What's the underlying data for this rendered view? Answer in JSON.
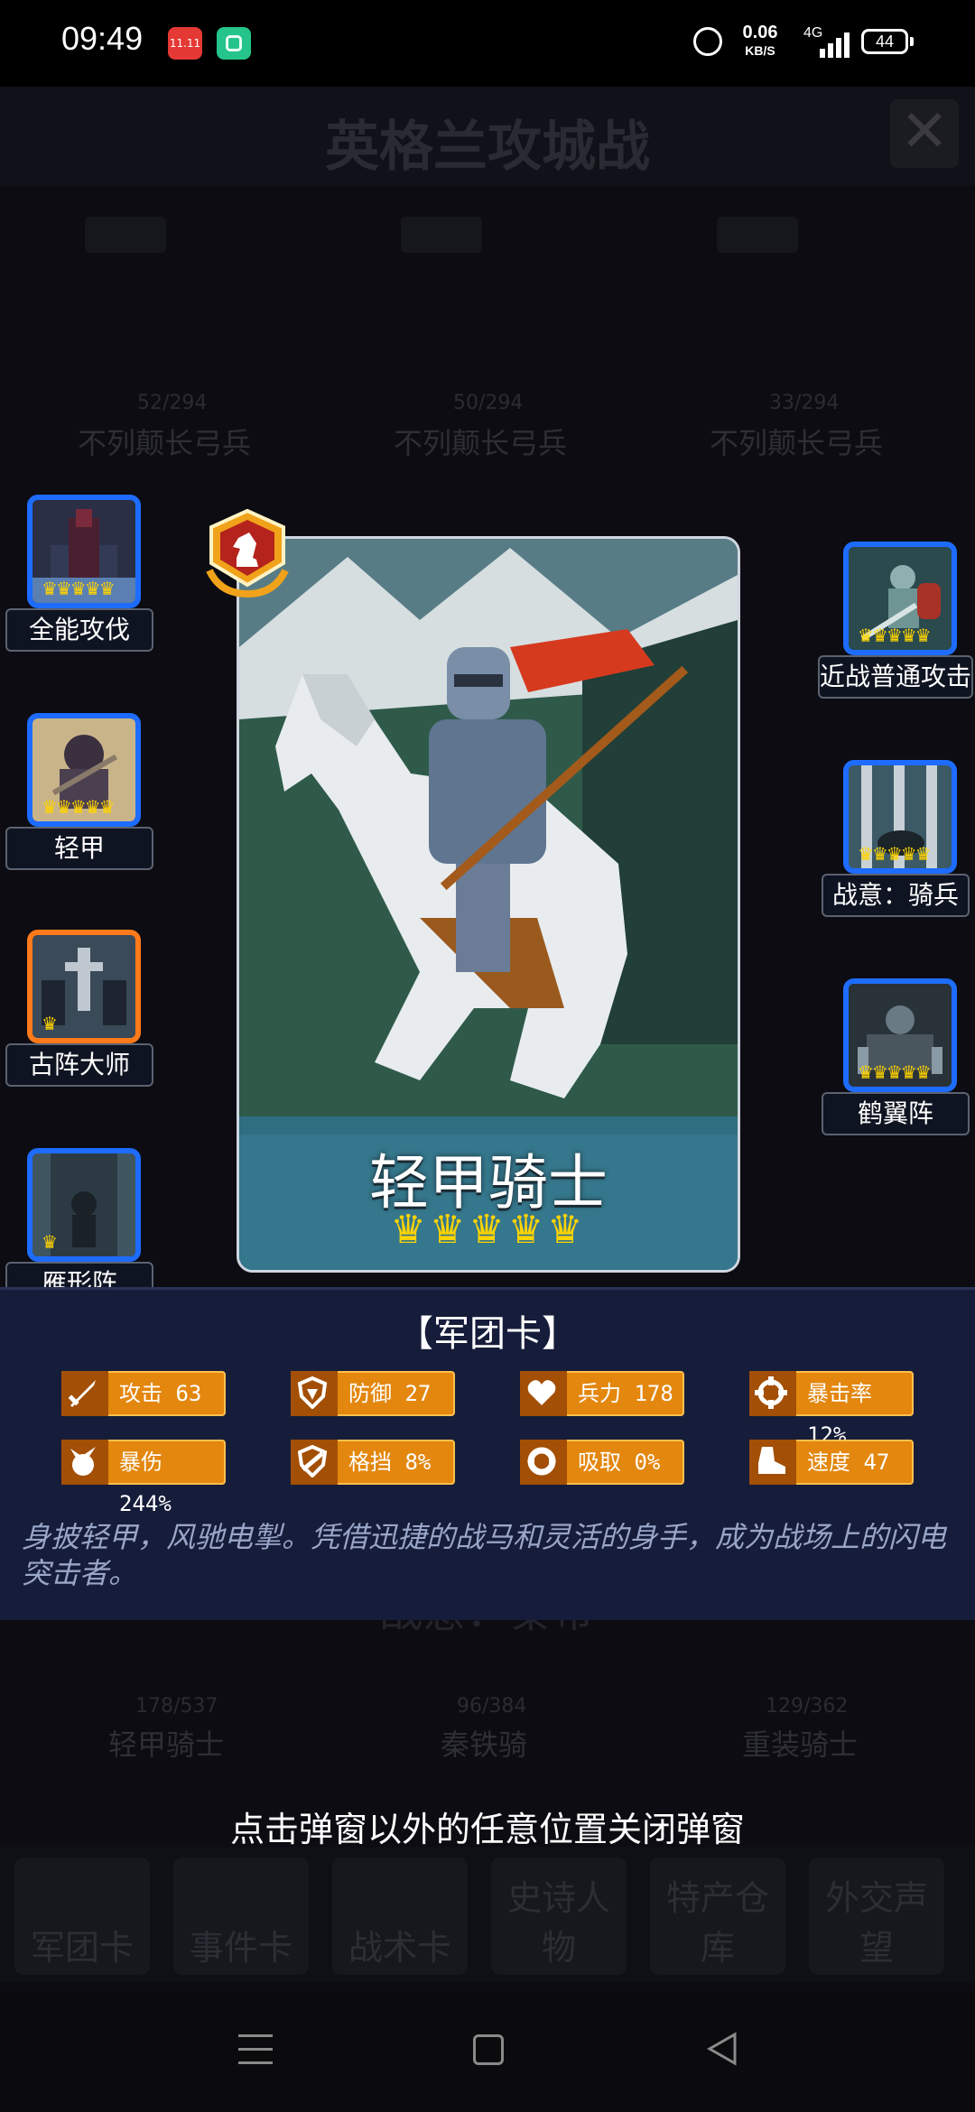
{
  "status_bar": {
    "time": "09:49",
    "app_badge": "11.11",
    "net_speed_value": "0.06",
    "net_speed_unit": "KB/S",
    "network": "4G",
    "battery": "44"
  },
  "background": {
    "title": "英格兰攻城战",
    "close_icon": "close-icon",
    "top_units": [
      {
        "stat": "52/294",
        "name": "不列颠长弓兵"
      },
      {
        "stat": "50/294",
        "name": "不列颠长弓兵"
      },
      {
        "stat": "33/294",
        "name": "不列颠长弓兵"
      }
    ],
    "center_text": "战意：秦帝",
    "bottom_units": [
      {
        "stat": "178/537",
        "name": "轻甲骑士"
      },
      {
        "stat": "96/384",
        "name": "秦铁骑"
      },
      {
        "stat": "129/362",
        "name": "重装骑士"
      }
    ],
    "hint": "点击弹窗以外的任意位置关闭弹窗",
    "nav": [
      "军团卡",
      "事件卡",
      "战术卡",
      "史诗人物",
      "特产仓库",
      "外交声望"
    ]
  },
  "skills_left": [
    {
      "label": "全能攻伐",
      "icon": "castle-icon",
      "crowns": "♛♛♛♛♛"
    },
    {
      "label": "轻甲",
      "icon": "hooded-warrior-icon",
      "crowns": "♛♛♛♛♛"
    },
    {
      "label": "古阵大师",
      "icon": "ancient-formation-icon",
      "crowns": "♛"
    },
    {
      "label": "雁形阵",
      "icon": "knight-formation-icon",
      "crowns": "♛"
    }
  ],
  "skills_right": [
    {
      "label": "近战普通攻击",
      "icon": "sword-knight-icon",
      "crowns": "♛♛♛♛♛"
    },
    {
      "label": "战意：骑兵",
      "icon": "cavalry-spirit-icon",
      "crowns": "♛♛♛♛♛"
    },
    {
      "label": "鹤翼阵",
      "icon": "crane-wing-formation-icon",
      "crowns": "♛♛♛♛♛"
    }
  ],
  "card": {
    "name": "轻甲骑士",
    "crowns": "♛♛♛♛♛",
    "badge_icon": "chess-knight-badge-icon"
  },
  "info": {
    "title": "【军团卡】",
    "stats": [
      {
        "label": "攻击 63",
        "icon": "sword-icon"
      },
      {
        "label": "防御 27",
        "icon": "shield-icon"
      },
      {
        "label": "兵力 178",
        "icon": "heart-icon"
      },
      {
        "label": "暴击率 12%",
        "icon": "crosshair-icon"
      },
      {
        "label": "暴伤 244%",
        "icon": "burst-icon"
      },
      {
        "label": "格挡 8%",
        "icon": "block-icon"
      },
      {
        "label": "吸取 0%",
        "icon": "absorb-icon"
      },
      {
        "label": "速度 47",
        "icon": "boot-icon"
      }
    ],
    "description": "身披轻甲，风驰电掣。凭借迅捷的战马和灵活的身手，成为战场上的闪电突击者。"
  },
  "colors": {
    "panel_bg": "#161d3a",
    "stat_bg": "#e3870e",
    "skill_border_blue": "#1e6cff",
    "skill_border_orange": "#ff7a1a",
    "crown": "#ffd400"
  }
}
